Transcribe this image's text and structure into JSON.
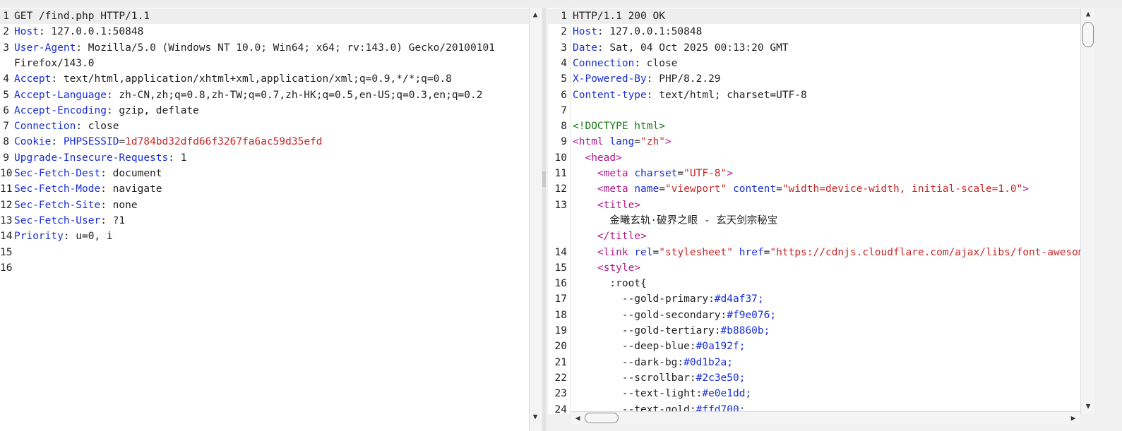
{
  "request": {
    "lines": [
      {
        "n": "1",
        "parts": [
          {
            "c": "v",
            "t": "GET /find.php HTTP/1.1"
          }
        ]
      },
      {
        "n": "2",
        "parts": [
          {
            "c": "k",
            "t": "Host"
          },
          {
            "c": "v",
            "t": ": 127.0.0.1:50848"
          }
        ]
      },
      {
        "n": "3",
        "parts": [
          {
            "c": "k",
            "t": "User-Agent"
          },
          {
            "c": "v",
            "t": ": Mozilla/5.0 (Windows NT 10.0; Win64; x64; rv:143.0) Gecko/20100101"
          }
        ]
      },
      {
        "n": "",
        "parts": [
          {
            "c": "v",
            "t": "Firefox/143.0"
          }
        ]
      },
      {
        "n": "4",
        "parts": [
          {
            "c": "k",
            "t": "Accept"
          },
          {
            "c": "v",
            "t": ": text/html,application/xhtml+xml,application/xml;q=0.9,*/*;q=0.8"
          }
        ]
      },
      {
        "n": "5",
        "parts": [
          {
            "c": "k",
            "t": "Accept-Language"
          },
          {
            "c": "v",
            "t": ": zh-CN,zh;q=0.8,zh-TW;q=0.7,zh-HK;q=0.5,en-US;q=0.3,en;q=0.2"
          }
        ]
      },
      {
        "n": "6",
        "parts": [
          {
            "c": "k",
            "t": "Accept-Encoding"
          },
          {
            "c": "v",
            "t": ": gzip, deflate"
          }
        ]
      },
      {
        "n": "7",
        "parts": [
          {
            "c": "k",
            "t": "Connection"
          },
          {
            "c": "v",
            "t": ": close"
          }
        ]
      },
      {
        "n": "8",
        "parts": [
          {
            "c": "k",
            "t": "Cookie"
          },
          {
            "c": "v",
            "t": ": "
          },
          {
            "c": "ck",
            "t": "PHPSESSID"
          },
          {
            "c": "v",
            "t": "="
          },
          {
            "c": "cv",
            "t": "1d784bd32dfd66f3267fa6ac59d35efd"
          }
        ]
      },
      {
        "n": "9",
        "parts": [
          {
            "c": "k",
            "t": "Upgrade-Insecure-Requests"
          },
          {
            "c": "v",
            "t": ": 1"
          }
        ]
      },
      {
        "n": "10",
        "parts": [
          {
            "c": "k",
            "t": "Sec-Fetch-Dest"
          },
          {
            "c": "v",
            "t": ": document"
          }
        ]
      },
      {
        "n": "11",
        "parts": [
          {
            "c": "k",
            "t": "Sec-Fetch-Mode"
          },
          {
            "c": "v",
            "t": ": navigate"
          }
        ]
      },
      {
        "n": "12",
        "parts": [
          {
            "c": "k",
            "t": "Sec-Fetch-Site"
          },
          {
            "c": "v",
            "t": ": none"
          }
        ]
      },
      {
        "n": "13",
        "parts": [
          {
            "c": "k",
            "t": "Sec-Fetch-User"
          },
          {
            "c": "v",
            "t": ": ?1"
          }
        ]
      },
      {
        "n": "14",
        "parts": [
          {
            "c": "k",
            "t": "Priority"
          },
          {
            "c": "v",
            "t": ": u=0, i"
          }
        ]
      },
      {
        "n": "15",
        "parts": []
      },
      {
        "n": "16",
        "parts": []
      }
    ]
  },
  "response": {
    "lines": [
      {
        "n": "1",
        "parts": [
          {
            "c": "v",
            "t": "HTTP/1.1 200 OK"
          }
        ]
      },
      {
        "n": "2",
        "parts": [
          {
            "c": "k",
            "t": "Host"
          },
          {
            "c": "v",
            "t": ": 127.0.0.1:50848"
          }
        ]
      },
      {
        "n": "3",
        "parts": [
          {
            "c": "k",
            "t": "Date"
          },
          {
            "c": "v",
            "t": ": Sat, 04 Oct 2025 00:13:20 GMT"
          }
        ]
      },
      {
        "n": "4",
        "parts": [
          {
            "c": "k",
            "t": "Connection"
          },
          {
            "c": "v",
            "t": ": close"
          }
        ]
      },
      {
        "n": "5",
        "parts": [
          {
            "c": "k",
            "t": "X-Powered-By"
          },
          {
            "c": "v",
            "t": ": PHP/8.2.29"
          }
        ]
      },
      {
        "n": "6",
        "parts": [
          {
            "c": "k",
            "t": "Content-type"
          },
          {
            "c": "v",
            "t": ": text/html; charset=UTF-8"
          }
        ]
      },
      {
        "n": "7",
        "parts": []
      },
      {
        "n": "8",
        "parts": [
          {
            "c": "dt",
            "t": "<!DOCTYPE html>"
          }
        ]
      },
      {
        "n": "9",
        "parts": [
          {
            "c": "tag",
            "t": "<html "
          },
          {
            "c": "attr",
            "t": "lang"
          },
          {
            "c": "v",
            "t": "="
          },
          {
            "c": "str",
            "t": "\"zh\""
          },
          {
            "c": "tag",
            "t": ">"
          }
        ]
      },
      {
        "n": "10",
        "parts": [
          {
            "c": "v",
            "t": "  "
          },
          {
            "c": "tag",
            "t": "<head>"
          }
        ]
      },
      {
        "n": "11",
        "parts": [
          {
            "c": "v",
            "t": "    "
          },
          {
            "c": "tag",
            "t": "<meta "
          },
          {
            "c": "attr",
            "t": "charset"
          },
          {
            "c": "v",
            "t": "="
          },
          {
            "c": "str",
            "t": "\"UTF-8\""
          },
          {
            "c": "tag",
            "t": ">"
          }
        ]
      },
      {
        "n": "12",
        "parts": [
          {
            "c": "v",
            "t": "    "
          },
          {
            "c": "tag",
            "t": "<meta "
          },
          {
            "c": "attr",
            "t": "name"
          },
          {
            "c": "v",
            "t": "="
          },
          {
            "c": "str",
            "t": "\"viewport\""
          },
          {
            "c": "v",
            "t": " "
          },
          {
            "c": "attr",
            "t": "content"
          },
          {
            "c": "v",
            "t": "="
          },
          {
            "c": "str",
            "t": "\"width=device-width, initial-scale=1.0\""
          },
          {
            "c": "tag",
            "t": ">"
          }
        ]
      },
      {
        "n": "13",
        "parts": [
          {
            "c": "v",
            "t": "    "
          },
          {
            "c": "tag",
            "t": "<title>"
          }
        ]
      },
      {
        "n": "",
        "parts": [
          {
            "c": "v",
            "t": "      金曦玄轨·破界之眼 - 玄天剑宗秘宝"
          }
        ]
      },
      {
        "n": "",
        "parts": [
          {
            "c": "v",
            "t": "    "
          },
          {
            "c": "tag",
            "t": "</title>"
          }
        ]
      },
      {
        "n": "14",
        "parts": [
          {
            "c": "v",
            "t": "    "
          },
          {
            "c": "tag",
            "t": "<link "
          },
          {
            "c": "attr",
            "t": "rel"
          },
          {
            "c": "v",
            "t": "="
          },
          {
            "c": "str",
            "t": "\"stylesheet\""
          },
          {
            "c": "v",
            "t": " "
          },
          {
            "c": "attr",
            "t": "href"
          },
          {
            "c": "v",
            "t": "="
          },
          {
            "c": "str",
            "t": "\"https://cdnjs.cloudflare.com/ajax/libs/font-awesome"
          }
        ]
      },
      {
        "n": "15",
        "parts": [
          {
            "c": "v",
            "t": "    "
          },
          {
            "c": "tag",
            "t": "<style>"
          }
        ]
      },
      {
        "n": "16",
        "parts": [
          {
            "c": "v",
            "t": "      :root{"
          }
        ]
      },
      {
        "n": "17",
        "parts": [
          {
            "c": "prop",
            "t": "        --gold-primary"
          },
          {
            "c": "v",
            "t": ":"
          },
          {
            "c": "pv",
            "t": "#d4af37;"
          }
        ]
      },
      {
        "n": "18",
        "parts": [
          {
            "c": "prop",
            "t": "        --gold-secondary"
          },
          {
            "c": "v",
            "t": ":"
          },
          {
            "c": "pv",
            "t": "#f9e076;"
          }
        ]
      },
      {
        "n": "19",
        "parts": [
          {
            "c": "prop",
            "t": "        --gold-tertiary"
          },
          {
            "c": "v",
            "t": ":"
          },
          {
            "c": "pv",
            "t": "#b8860b;"
          }
        ]
      },
      {
        "n": "20",
        "parts": [
          {
            "c": "prop",
            "t": "        --deep-blue"
          },
          {
            "c": "v",
            "t": ":"
          },
          {
            "c": "pv",
            "t": "#0a192f;"
          }
        ]
      },
      {
        "n": "21",
        "parts": [
          {
            "c": "prop",
            "t": "        --dark-bg"
          },
          {
            "c": "v",
            "t": ":"
          },
          {
            "c": "pv",
            "t": "#0d1b2a;"
          }
        ]
      },
      {
        "n": "22",
        "parts": [
          {
            "c": "prop",
            "t": "        --scrollbar"
          },
          {
            "c": "v",
            "t": ":"
          },
          {
            "c": "pv",
            "t": "#2c3e50;"
          }
        ]
      },
      {
        "n": "23",
        "parts": [
          {
            "c": "prop",
            "t": "        --text-light"
          },
          {
            "c": "v",
            "t": ":"
          },
          {
            "c": "pv",
            "t": "#e0e1dd;"
          }
        ]
      },
      {
        "n": "24",
        "parts": [
          {
            "c": "prop",
            "t": "        --text-gold"
          },
          {
            "c": "v",
            "t": ":"
          },
          {
            "c": "pv",
            "t": "#ffd700;"
          }
        ]
      }
    ]
  },
  "icons": {
    "up": "▲",
    "down": "▼",
    "left": "◀",
    "right": "▶"
  }
}
